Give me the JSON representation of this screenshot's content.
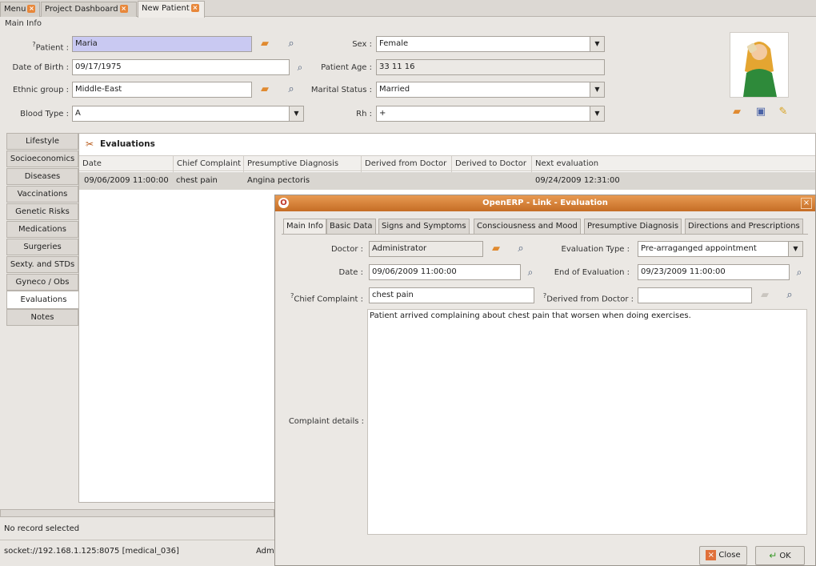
{
  "tabs": [
    {
      "label": "Menu"
    },
    {
      "label": "Project Dashboard"
    },
    {
      "label": "New Patient"
    }
  ],
  "main_info": {
    "section_label": "Main Info",
    "patient_label": "Patient :",
    "patient_marker": "?",
    "patient_value": "Maria",
    "dob_label": "Date of Birth :",
    "dob_value": "09/17/1975",
    "ethnic_label": "Ethnic group :",
    "ethnic_value": "Middle-East",
    "blood_label": "Blood Type :",
    "blood_value": "A",
    "sex_label": "Sex :",
    "sex_value": "Female",
    "age_label": "Patient Age :",
    "age_value": "33 11 16",
    "marital_label": "Marital Status :",
    "marital_value": "Married",
    "rh_label": "Rh :",
    "rh_value": "+"
  },
  "side_tabs": [
    "Lifestyle",
    "Socioeconomics",
    "Diseases",
    "Vaccinations",
    "Genetic Risks",
    "Medications",
    "Surgeries",
    "Sexty. and STDs",
    "Gyneco / Obs",
    "Evaluations",
    "Notes"
  ],
  "evaluations": {
    "title": "Evaluations",
    "columns": [
      "Date",
      "Chief Complaint",
      "Presumptive Diagnosis",
      "Derived from Doctor",
      "Derived to Doctor",
      "Next evaluation"
    ],
    "rows": [
      {
        "date": "09/06/2009 11:00:00",
        "complaint": "chest pain",
        "diagnosis": "Angina pectoris",
        "from": "",
        "to": "",
        "next": "09/24/2009 12:31:00"
      }
    ]
  },
  "status": {
    "record": "No record selected",
    "socket": "socket://192.168.1.125:8075 [medical_036]",
    "user": "Adm"
  },
  "dialog": {
    "title": "OpenERP - Link - Evaluation",
    "tabs": [
      "Main Info",
      "Basic Data",
      "Signs and Symptoms",
      "Consciousness and Mood",
      "Presumptive Diagnosis",
      "Directions and Prescriptions"
    ],
    "doctor_label": "Doctor :",
    "doctor_value": "Administrator",
    "eval_type_label": "Evaluation Type :",
    "eval_type_value": "Pre-arraganged appointment",
    "date_label": "Date :",
    "date_value": "09/06/2009 11:00:00",
    "end_label": "End of Evaluation :",
    "end_value": "09/23/2009 11:00:00",
    "chief_label": "Chief Complaint :",
    "chief_marker": "?",
    "chief_value": "chest pain",
    "derived_label": "Derived from Doctor :",
    "derived_marker": "?",
    "derived_value": "",
    "details_label": "Complaint details :",
    "details_value": "Patient arrived complaining about chest pain that worsen when doing exercises.",
    "close_label": "Close",
    "ok_label": "OK"
  },
  "colors": {
    "accent": "#e08a30",
    "highlight_input": "#c9c9f2",
    "dialog_title": "#d27a33"
  }
}
